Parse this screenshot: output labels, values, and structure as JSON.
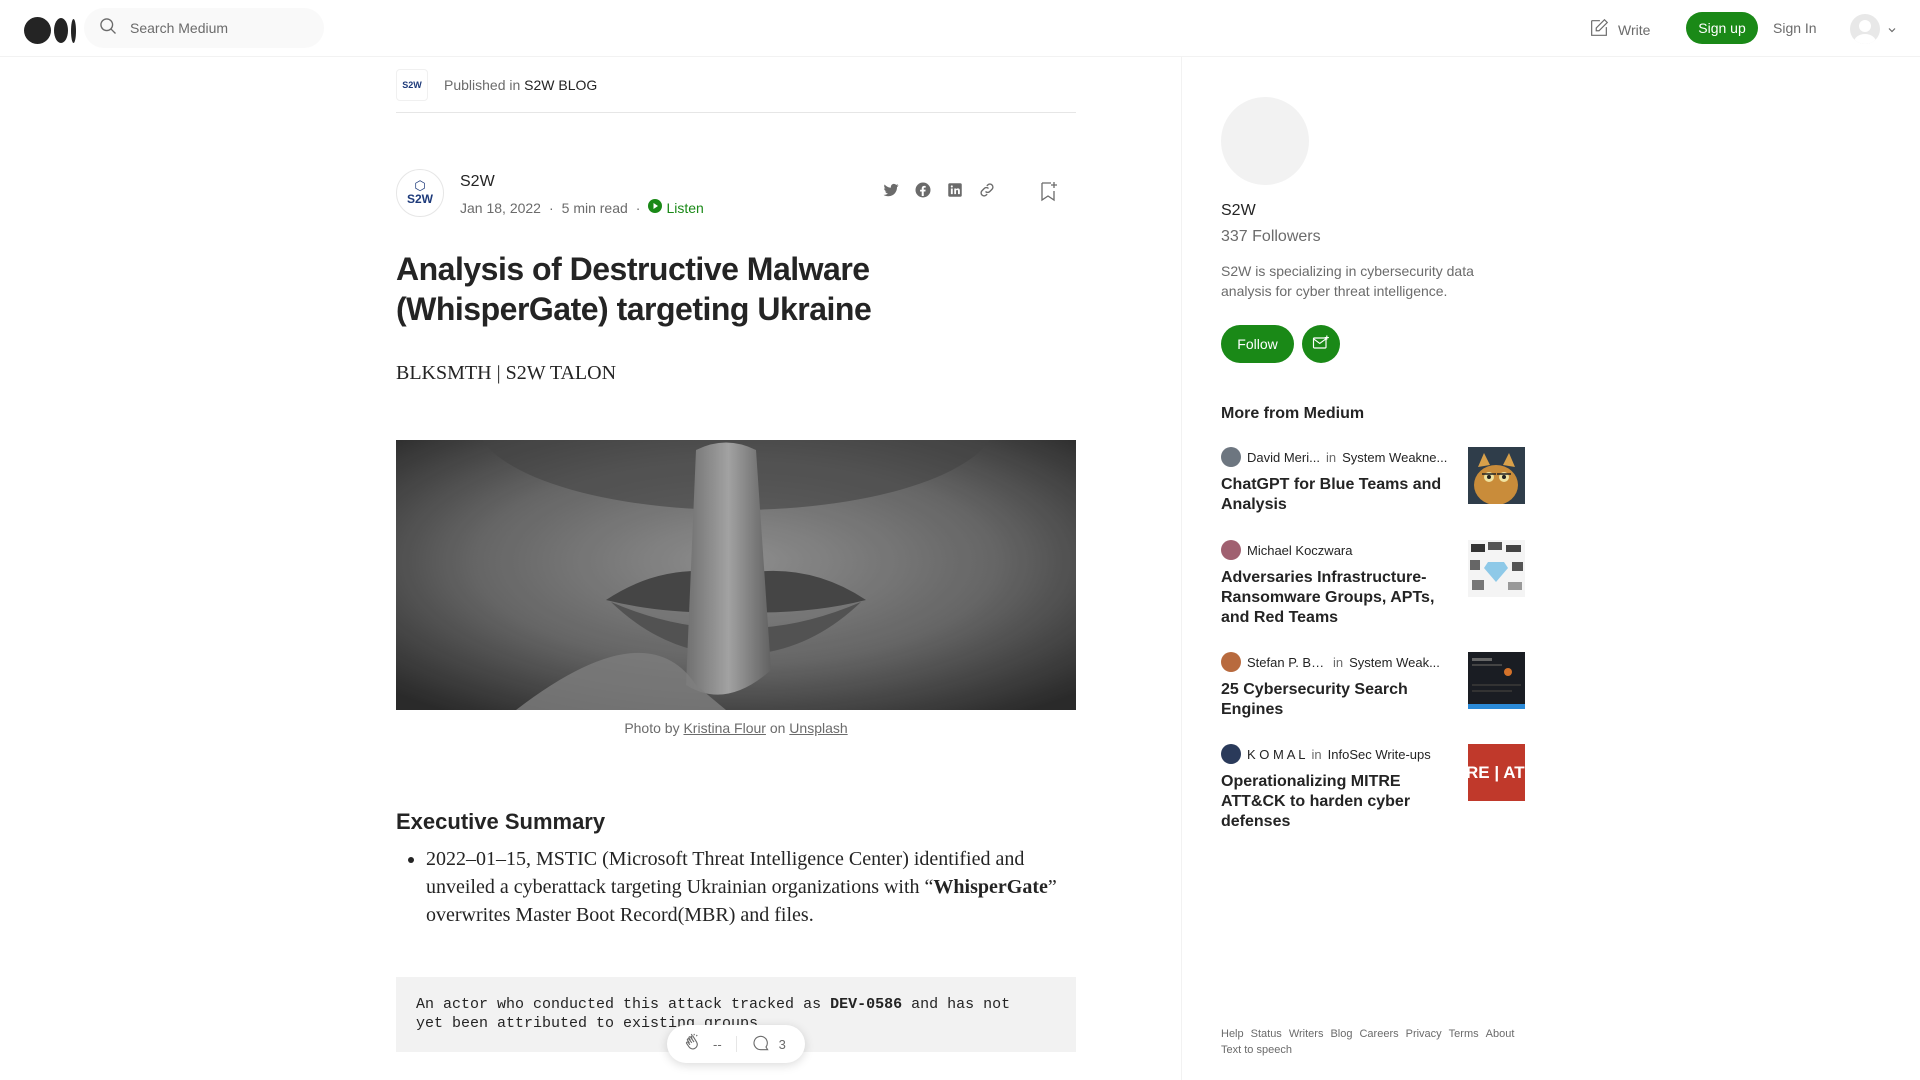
{
  "header": {
    "search_placeholder": "Search Medium",
    "write_label": "Write",
    "signup_label": "Sign up",
    "signin_label": "Sign In"
  },
  "article": {
    "published_prefix": "Published in",
    "publication": "S2W BLOG",
    "publication_logo_text": "S2W",
    "author": "S2W",
    "date": "Jan 18, 2022",
    "read_time": "5 min read",
    "listen_label": "Listen",
    "title": "Analysis of Destructive Malware (WhisperGate) targeting Ukraine",
    "subtitle": "BLKSMTH | S2W TALON",
    "caption_prefix": "Photo by",
    "caption_photographer": "Kristina Flour",
    "caption_on": "on",
    "caption_source": "Unsplash",
    "section_heading": "Executive Summary",
    "bullet_1a": "2022–01–15, MSTIC (Microsoft Threat Intelligence Center) identified and unveiled a cyberattack targeting Ukrainian organizations with “",
    "bullet_1b": "WhisperGate",
    "bullet_1c": "” overwrites Master Boot Record(MBR) and files.",
    "code_1a": "An actor who conducted this attack tracked as ",
    "code_1b": "DEV-0586",
    "code_1c": " and has not",
    "code_2": "yet been attributed to existing groups",
    "claps": "--",
    "responses": "3"
  },
  "sidebar": {
    "name": "S2W",
    "followers": "337 Followers",
    "bio": "S2W is specializing in cybersecurity data analysis for cyber threat intelligence.",
    "follow_label": "Follow",
    "more_title": "More from Medium",
    "recs": [
      {
        "author": "David Meri...",
        "in": "in",
        "pub": "System Weakne...",
        "title": "ChatGPT for Blue Teams and Analysis"
      },
      {
        "author": "Michael Koczwara",
        "in": "",
        "pub": "",
        "title": "Adversaries Infrastructure-Ransomware Groups, APTs, and Red Teams"
      },
      {
        "author": "Stefan P. Bar...",
        "in": "in",
        "pub": "System Weak...",
        "title": "25 Cybersecurity Search Engines"
      },
      {
        "author": "K O M A L",
        "in": "in",
        "pub": "InfoSec Write-ups",
        "title": "Operationalizing MITRE ATT&CK to harden cyber defenses"
      }
    ],
    "thumb4_text": "RE | AT"
  },
  "footer": {
    "links": [
      "Help",
      "Status",
      "Writers",
      "Blog",
      "Careers",
      "Privacy",
      "Terms",
      "About",
      "Text to speech"
    ]
  },
  "colors": {
    "accent": "#1a8917",
    "text": "#242424",
    "muted": "#6b6b6b"
  },
  "icons": [
    "medium-logo",
    "search-icon",
    "write-icon",
    "chevron-down-icon",
    "twitter-icon",
    "facebook-icon",
    "linkedin-icon",
    "link-icon",
    "bookmark-icon",
    "play-icon",
    "clap-icon",
    "comment-icon",
    "subscribe-mail-icon"
  ]
}
